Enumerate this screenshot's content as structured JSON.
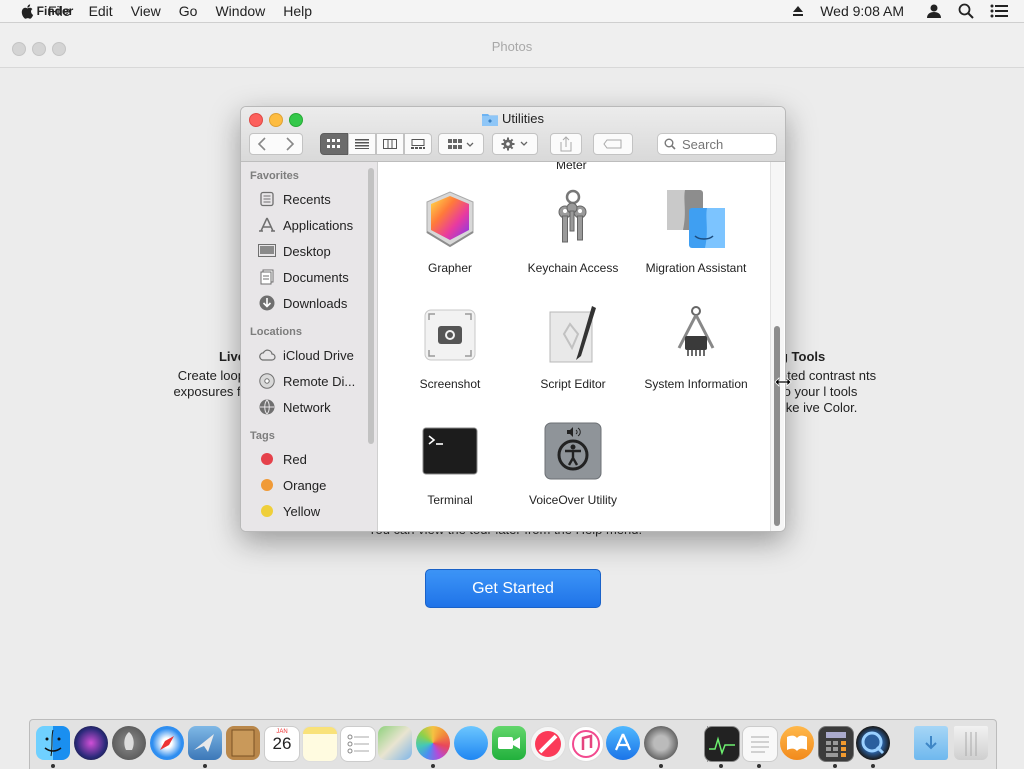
{
  "menubar": {
    "app_name": "Finder",
    "menus": [
      "File",
      "Edit",
      "View",
      "Go",
      "Window",
      "Help"
    ],
    "clock": "Wed 9:08 AM",
    "icons": [
      "apple-icon",
      "eject-icon",
      "user-icon",
      "spotlight-icon",
      "control-strip-icon"
    ]
  },
  "photos_window": {
    "title": "Photos",
    "left_feature": {
      "title": "Live",
      "body": "Create loop exposures fr"
    },
    "right_feature": {
      "title": "g Tools",
      "body": "ated contrast nts to your l tools like ive Color."
    },
    "tour_note": "You can view the tour later from the Help menu.",
    "get_started": "Get Started"
  },
  "finder": {
    "title": "Utilities",
    "search_placeholder": "Search",
    "sidebar": {
      "favorites_heading": "Favorites",
      "favorites": [
        "Recents",
        "Applications",
        "Desktop",
        "Documents",
        "Downloads"
      ],
      "locations_heading": "Locations",
      "locations": [
        "iCloud Drive",
        "Remote Di...",
        "Network"
      ],
      "tags_heading": "Tags",
      "tags": [
        {
          "name": "Red",
          "color": "#e5414a"
        },
        {
          "name": "Orange",
          "color": "#f09a37"
        },
        {
          "name": "Yellow",
          "color": "#efcf3a"
        }
      ]
    },
    "partial_label": "Meter",
    "apps": [
      "Grapher",
      "Keychain Access",
      "Migration Assistant",
      "Screenshot",
      "Script Editor",
      "System Information",
      "Terminal",
      "VoiceOver Utility"
    ]
  },
  "dock": {
    "items": [
      "finder-icon",
      "siri-icon",
      "launchpad-icon",
      "safari-icon",
      "mail-icon",
      "contacts-icon",
      "calendar-icon",
      "notes-icon",
      "reminders-icon",
      "maps-icon",
      "photos-icon",
      "messages-icon",
      "facetime-icon",
      "news-icon",
      "itunes-icon",
      "app-store-icon",
      "system-preferences-icon",
      "activity-monitor-icon",
      "textedit-icon",
      "ibooks-icon",
      "calculator-icon",
      "quicktime-icon",
      "downloads-folder-icon",
      "trash-icon"
    ],
    "calendar_day": "26",
    "calendar_month": "JAN"
  }
}
